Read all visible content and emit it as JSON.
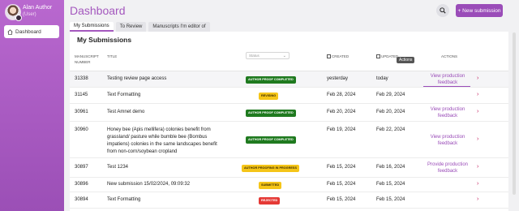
{
  "user": {
    "name": "Alan Author",
    "role": "(User)"
  },
  "nav": {
    "dashboard": "Dashboard"
  },
  "header": {
    "title": "Dashboard",
    "new_submission": "+ New submission"
  },
  "tabs": [
    "My Submissions",
    "To Review",
    "Manuscripts I'm editor of"
  ],
  "card": {
    "title": "My Submissions"
  },
  "table": {
    "headers": {
      "manuscript_number": "Manuscript Number",
      "title": "Title",
      "status": "Status",
      "created": "Created",
      "updated": "Updated",
      "actions": "Actions"
    },
    "rows": [
      {
        "number": "31338",
        "title": "Testing review page access",
        "status": "AUTHOR PROOF COMPLETED",
        "status_color": "green",
        "created": "yesterday",
        "updated": "today",
        "action": "View production feedback",
        "hover": true
      },
      {
        "number": "31145",
        "title": "Text Formatting",
        "status": "REVISING",
        "status_color": "yellow",
        "created": "Feb 28, 2024",
        "updated": "Feb 29, 2024",
        "action": ""
      },
      {
        "number": "30961",
        "title": "Test Amnet demo",
        "status": "AUTHOR PROOF COMPLETED",
        "status_color": "green",
        "created": "Feb 20, 2024",
        "updated": "Feb 20, 2024",
        "action": "View production feedback"
      },
      {
        "number": "30960",
        "title": "Honey bee (Apis mellifera) colonies benefit from grassland/ pasture while bumble bee (Bombus impatiens) colonies in the same landscapes benefit from non-corn/soybean cropland",
        "status": "AUTHOR PROOF COMPLETED",
        "status_color": "green",
        "created": "Feb 19, 2024",
        "updated": "Feb 22, 2024",
        "action": "View production feedback"
      },
      {
        "number": "30897",
        "title": "Test 1234",
        "status": "AUTHOR PROOFING IN PROGRESS",
        "status_color": "yellow",
        "created": "Feb 15, 2024",
        "updated": "Feb 16, 2024",
        "action": "Provide production feedback"
      },
      {
        "number": "30896",
        "title": "New submission 15/02/2024, 09:09:32",
        "status": "SUBMITTED",
        "status_color": "yellow",
        "created": "Feb 15, 2024",
        "updated": "Feb 15, 2024",
        "action": ""
      },
      {
        "number": "30894",
        "title": "Text Formatting",
        "status": "REJECTED",
        "status_color": "red",
        "created": "Feb 15, 2024",
        "updated": "Feb 15, 2024",
        "action": ""
      }
    ]
  },
  "tooltip": "Actions"
}
